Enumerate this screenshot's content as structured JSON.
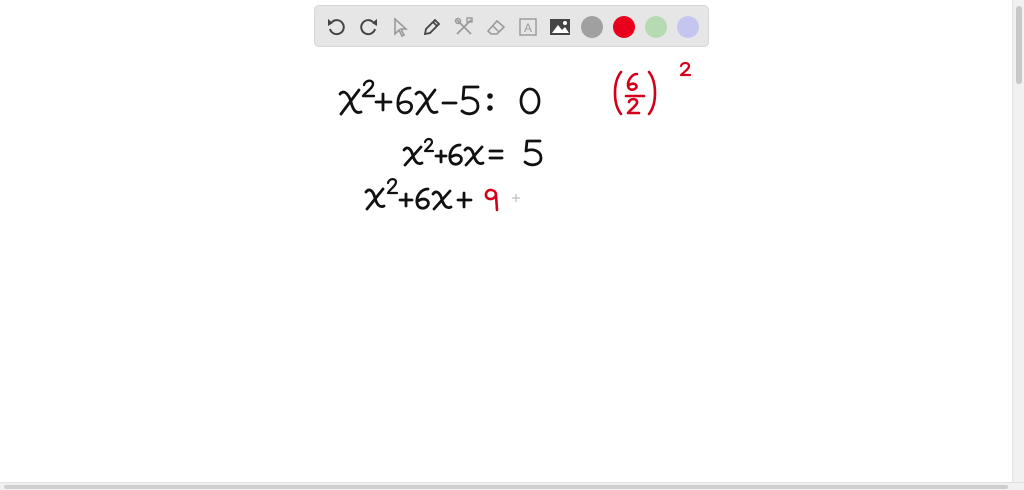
{
  "toolbar": {
    "tools": [
      {
        "name": "undo-icon",
        "active": true
      },
      {
        "name": "redo-icon",
        "active": true
      },
      {
        "name": "select-pointer-icon",
        "active": false
      },
      {
        "name": "pen-icon",
        "active": true
      },
      {
        "name": "tools-icon",
        "active": false
      },
      {
        "name": "eraser-icon",
        "active": false
      },
      {
        "name": "text-icon",
        "active": false
      },
      {
        "name": "image-icon",
        "active": true
      }
    ],
    "text_tool_glyph": "A",
    "colors": [
      {
        "name": "gray",
        "hex": "#a0a0a0"
      },
      {
        "name": "red",
        "hex": "#e8001c"
      },
      {
        "name": "green",
        "hex": "#b6dbb3"
      },
      {
        "name": "purple",
        "hex": "#c5c6f0"
      }
    ],
    "selected_color": "red"
  },
  "whiteboard": {
    "ink_color": "#111111",
    "accent_color": "#d4001b"
  }
}
